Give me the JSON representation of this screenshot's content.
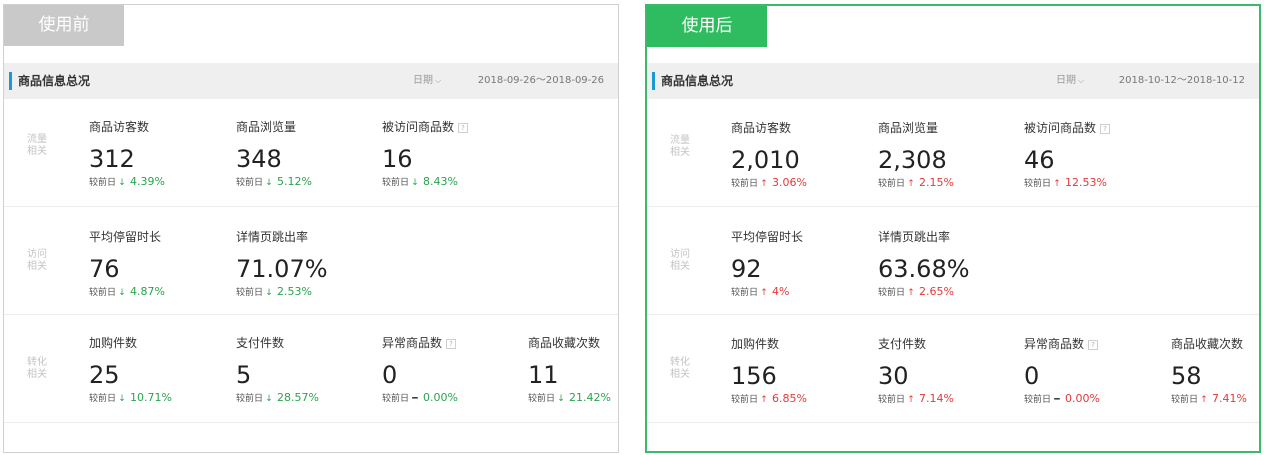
{
  "panels": [
    {
      "tag": "使用前",
      "title": "商品信息总况",
      "date_label": "日期",
      "date_range": "2018-09-26～2018-09-26",
      "compare_label": "较前日",
      "sections": [
        {
          "label_line1": "流量",
          "label_line2": "相关",
          "metrics": [
            {
              "label": "商品访客数",
              "value": "312",
              "trend": "down",
              "arrow": "↓",
              "pct": "4.39%",
              "help": false
            },
            {
              "label": "商品浏览量",
              "value": "348",
              "trend": "down",
              "arrow": "↓",
              "pct": "5.12%",
              "help": false
            },
            {
              "label": "被访问商品数",
              "value": "16",
              "trend": "down",
              "arrow": "↓",
              "pct": "8.43%",
              "help": true
            }
          ]
        },
        {
          "label_line1": "访问",
          "label_line2": "相关",
          "metrics": [
            {
              "label": "平均停留时长",
              "value": "76",
              "trend": "down",
              "arrow": "↓",
              "pct": "4.87%",
              "help": false
            },
            {
              "label": "详情页跳出率",
              "value": "71.07%",
              "trend": "down",
              "arrow": "↓",
              "pct": "2.53%",
              "help": false
            }
          ]
        },
        {
          "label_line1": "转化",
          "label_line2": "相关",
          "metrics": [
            {
              "label": "加购件数",
              "value": "25",
              "trend": "down",
              "arrow": "↓",
              "pct": "10.71%",
              "help": false
            },
            {
              "label": "支付件数",
              "value": "5",
              "trend": "down",
              "arrow": "↓",
              "pct": "28.57%",
              "help": false
            },
            {
              "label": "异常商品数",
              "value": "0",
              "trend": "flat",
              "arrow": "━",
              "pct": "0.00%",
              "help": true
            },
            {
              "label": "商品收藏次数",
              "value": "11",
              "trend": "down",
              "arrow": "↓",
              "pct": "21.42%",
              "help": false
            }
          ]
        }
      ]
    },
    {
      "tag": "使用后",
      "title": "商品信息总况",
      "date_label": "日期",
      "date_range": "2018-10-12～2018-10-12",
      "compare_label": "较前日",
      "sections": [
        {
          "label_line1": "流量",
          "label_line2": "相关",
          "metrics": [
            {
              "label": "商品访客数",
              "value": "2,010",
              "trend": "up",
              "arrow": "↑",
              "pct": "3.06%",
              "help": false
            },
            {
              "label": "商品浏览量",
              "value": "2,308",
              "trend": "up",
              "arrow": "↑",
              "pct": "2.15%",
              "help": false
            },
            {
              "label": "被访问商品数",
              "value": "46",
              "trend": "up",
              "arrow": "↑",
              "pct": "12.53%",
              "help": true
            }
          ]
        },
        {
          "label_line1": "访问",
          "label_line2": "相关",
          "metrics": [
            {
              "label": "平均停留时长",
              "value": "92",
              "trend": "up",
              "arrow": "↑",
              "pct": "4%",
              "help": false
            },
            {
              "label": "详情页跳出率",
              "value": "63.68%",
              "trend": "up",
              "arrow": "↑",
              "pct": "2.65%",
              "help": false
            }
          ]
        },
        {
          "label_line1": "转化",
          "label_line2": "相关",
          "metrics": [
            {
              "label": "加购件数",
              "value": "156",
              "trend": "up",
              "arrow": "↑",
              "pct": "6.85%",
              "help": false
            },
            {
              "label": "支付件数",
              "value": "30",
              "trend": "up",
              "arrow": "↑",
              "pct": "7.14%",
              "help": false
            },
            {
              "label": "异常商品数",
              "value": "0",
              "trend": "flat",
              "arrow": "━",
              "pct": "0.00%",
              "help": true
            },
            {
              "label": "商品收藏次数",
              "value": "58",
              "trend": "up",
              "arrow": "↑",
              "pct": "7.41%",
              "help": false
            }
          ]
        }
      ]
    }
  ],
  "help_icon_glyph": "?",
  "chevron_glyph": "⌵",
  "colors": {
    "before_tag": "#c9c9c9",
    "after_tag": "#2fbb5f",
    "after_border": "#3cb96b",
    "down": "#2aa34f",
    "up": "#e23a3a",
    "title_bar": "#1a9bd7"
  }
}
